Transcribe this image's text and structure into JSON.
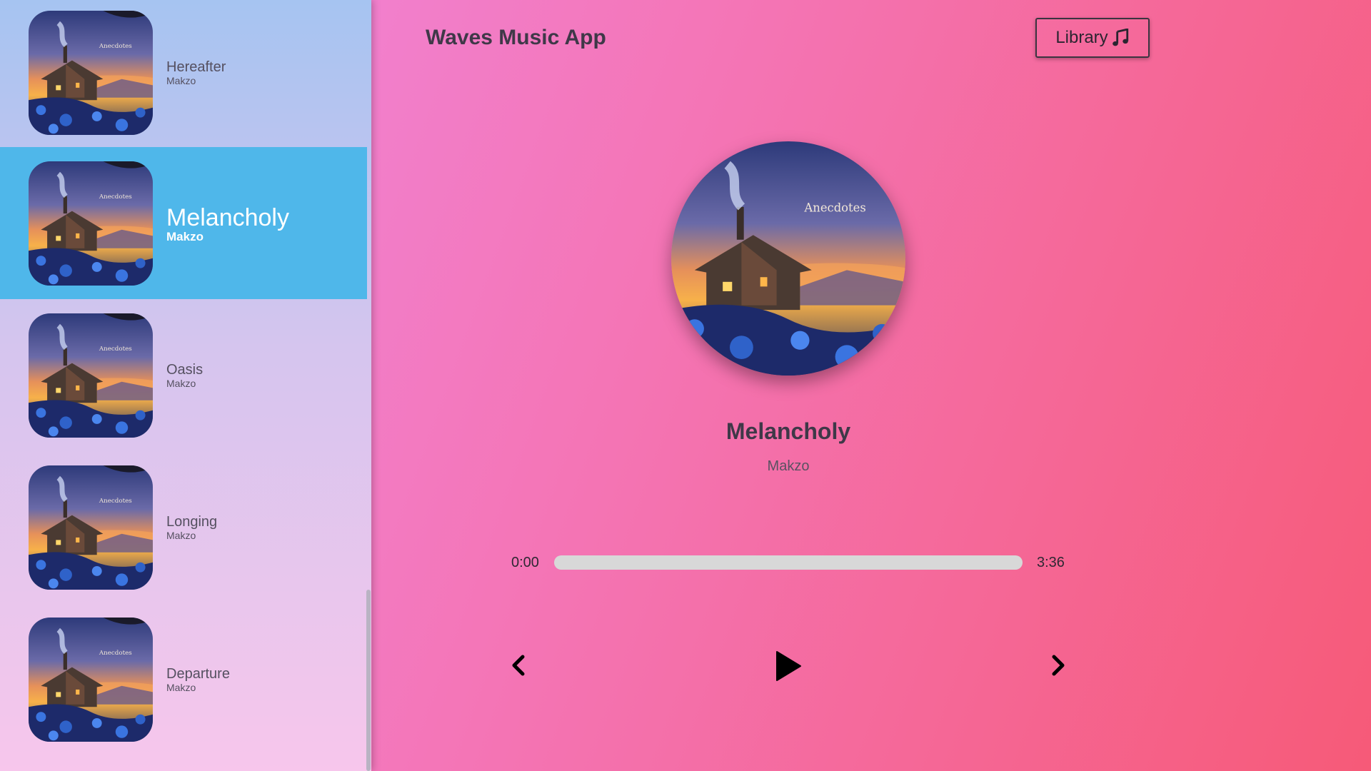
{
  "app": {
    "title": "Waves Music App",
    "library_button_label": "Library"
  },
  "library": {
    "songs": [
      {
        "name": "Hereafter",
        "artist": "Makzo",
        "active": false
      },
      {
        "name": "Melancholy",
        "artist": "Makzo",
        "active": true
      },
      {
        "name": "Oasis",
        "artist": "Makzo",
        "active": false
      },
      {
        "name": "Longing",
        "artist": "Makzo",
        "active": false
      },
      {
        "name": "Departure",
        "artist": "Makzo",
        "active": false
      }
    ]
  },
  "player": {
    "song_title": "Melancholy",
    "artist": "Makzo",
    "current_time": "0:00",
    "duration": "3:36",
    "progress": 0,
    "album_art_text": "Anecdotes",
    "controls": {
      "previous": "chevron-left-icon",
      "play": "play-icon",
      "next": "chevron-right-icon"
    }
  },
  "colors": {
    "active_song_bg": "#4fb7ea",
    "title_text": "#3f3848",
    "track": "#d8d8d8"
  }
}
